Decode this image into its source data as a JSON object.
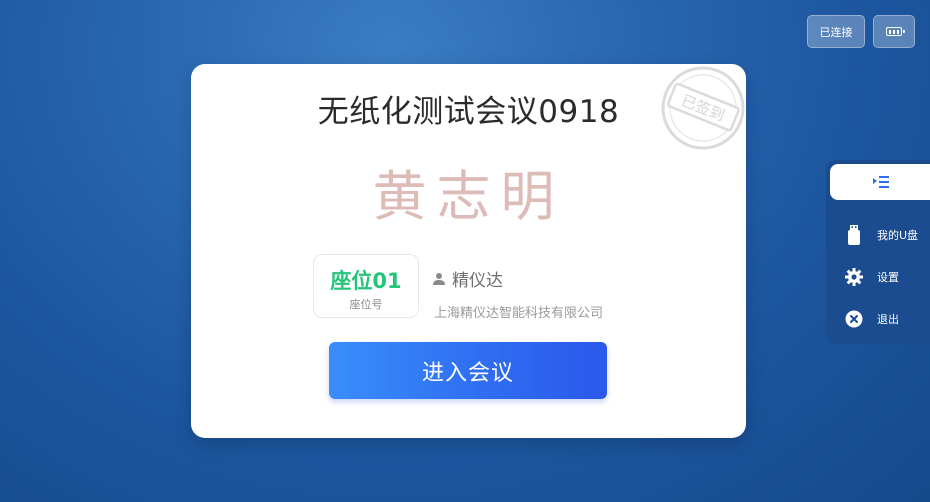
{
  "status": {
    "connected_label": "已连接",
    "battery_icon": "battery-icon"
  },
  "card": {
    "meeting_title": "无纸化测试会议0918",
    "stamp_text": "已签到",
    "signature_name": "黄志明",
    "seat": {
      "value": "座位01",
      "label": "座位号"
    },
    "person_icon": "person-icon",
    "person_name": "精仪达",
    "company": "上海精仪达智能科技有限公司",
    "enter_button": "进入会议"
  },
  "side_menu": {
    "toggle_icon": "menu-collapse-icon",
    "items": [
      {
        "label": "我的U盘",
        "icon": "usb-drive-icon"
      },
      {
        "label": "设置",
        "icon": "gear-icon"
      },
      {
        "label": "退出",
        "icon": "close-circle-icon"
      }
    ]
  },
  "colors": {
    "accent_blue": "#2f6ef2",
    "seat_green": "#24c47a",
    "signature": "#ddbcb7",
    "panel": "#1b4c8f"
  }
}
